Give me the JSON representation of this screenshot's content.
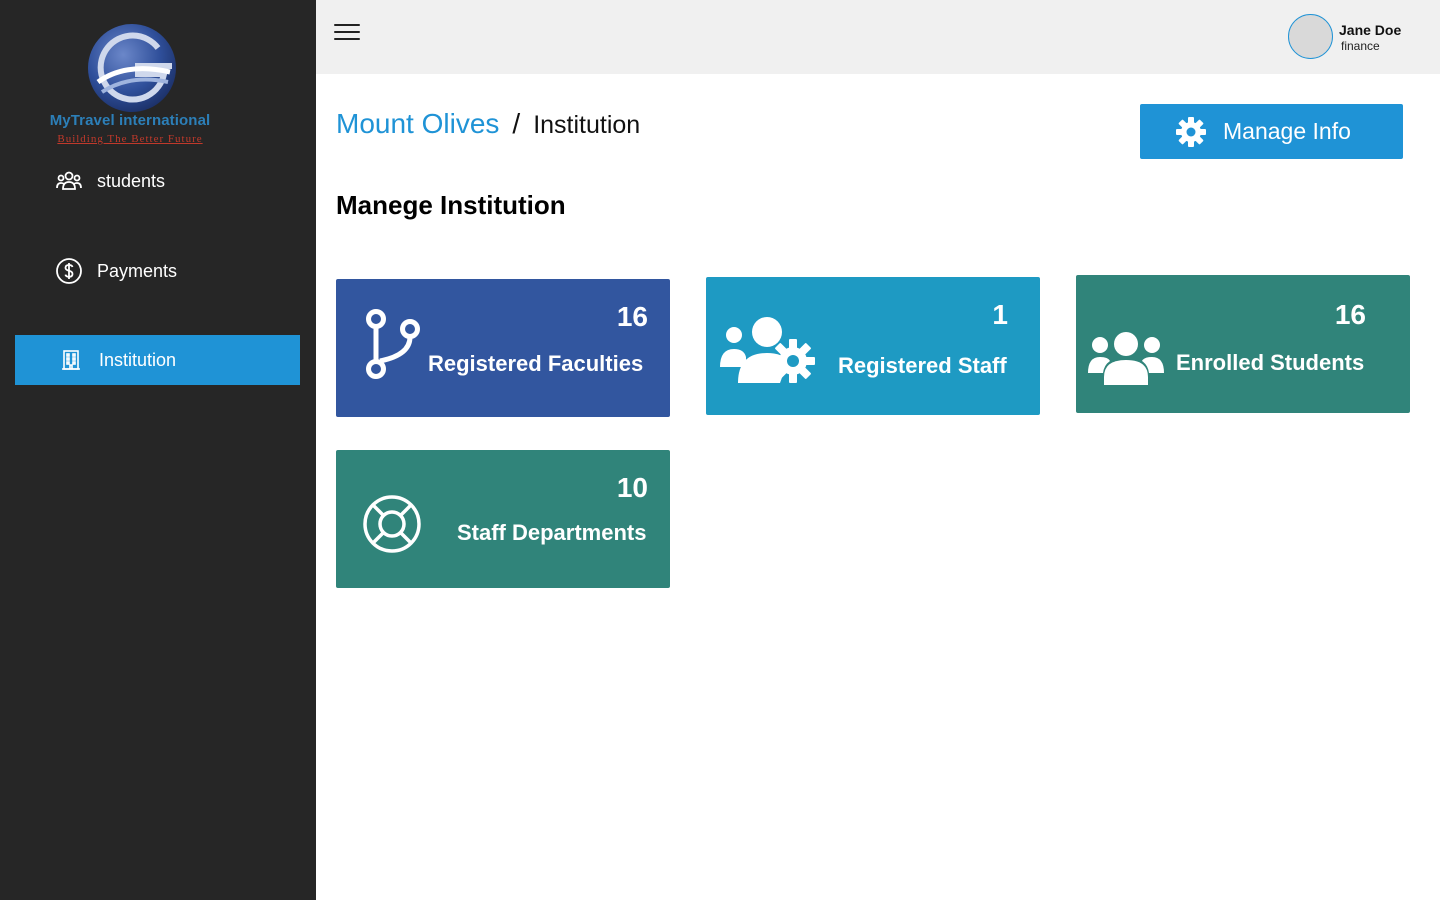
{
  "brand": {
    "name": "MyTravel international",
    "tagline": "Building The Better Future",
    "colors": {
      "name": "#2c7fb8",
      "tagline": "#c0392b"
    }
  },
  "sidebar": {
    "background": "#262626",
    "active_color": "#1f93d6",
    "items": [
      {
        "label": "students",
        "icon": "users-icon",
        "active": false
      },
      {
        "label": "Payments",
        "icon": "dollar-circle-icon",
        "active": false
      },
      {
        "label": "Institution",
        "icon": "building-icon",
        "active": true
      }
    ]
  },
  "header": {
    "menu_icon": "hamburger-icon",
    "user": {
      "name": "Jane Doe",
      "role": "finance"
    }
  },
  "breadcrumb": {
    "parent": "Mount Olives",
    "separator": "/",
    "current": "Institution"
  },
  "actions": {
    "manage_label": "Manage Info",
    "manage_icon": "gear-icon"
  },
  "page_title": "Manege Institution",
  "cards": [
    {
      "count": "16",
      "label": "Registered Faculties",
      "icon": "branch-icon",
      "color": "#32569f"
    },
    {
      "count": "1",
      "label": "Registered Staff",
      "icon": "users-gear-icon",
      "color": "#1e9ac3"
    },
    {
      "count": "16",
      "label": "Enrolled Students",
      "icon": "user-group-icon",
      "color": "#30847a"
    },
    {
      "count": "10",
      "label": "Staff Departments",
      "icon": "lifebuoy-icon",
      "color": "#30847a"
    }
  ]
}
